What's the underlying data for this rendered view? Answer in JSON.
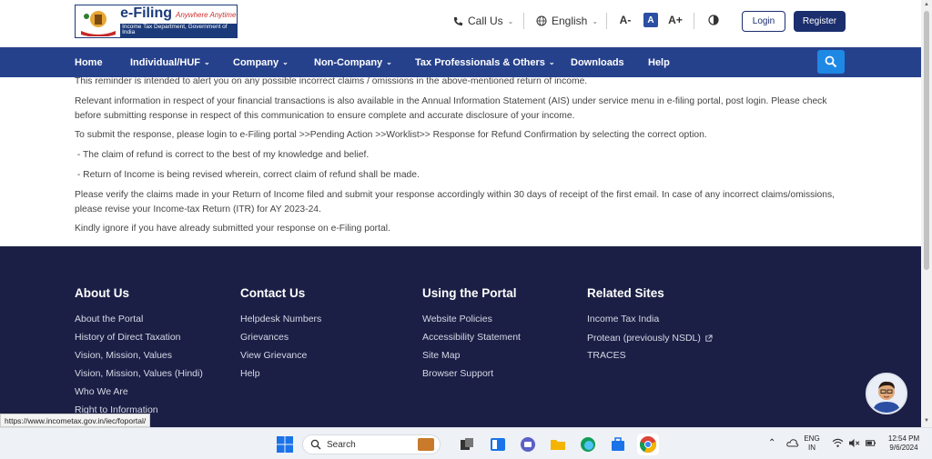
{
  "header": {
    "logo": {
      "title": "e-Filing",
      "tagline": "Anywhere Anytime",
      "subtitle": "Income Tax Department, Government of India"
    },
    "call_us": "Call Us",
    "language": "English",
    "font_decrease": "A-",
    "font_normal": "A",
    "font_increase": "A+",
    "login": "Login",
    "register": "Register"
  },
  "nav": {
    "items": [
      {
        "label": "Home",
        "dropdown": false
      },
      {
        "label": "Individual/HUF",
        "dropdown": true
      },
      {
        "label": "Company",
        "dropdown": true
      },
      {
        "label": "Non-Company",
        "dropdown": true
      },
      {
        "label": "Tax Professionals & Others",
        "dropdown": true
      },
      {
        "label": "Downloads",
        "dropdown": false
      },
      {
        "label": "Help",
        "dropdown": false
      }
    ]
  },
  "content": {
    "paragraphs": [
      "This reminder is intended to alert you on any possible incorrect claims / omissions in the above-mentioned return of income.",
      "Relevant information in respect of your financial transactions is also available in the Annual Information Statement (AIS) under service menu in e-filing portal, post login. Please check before submitting response in respect of this communication to ensure complete and accurate disclosure of your income.",
      "To submit the response, please login to e-Filing portal >>Pending Action >>Worklist>> Response for Refund Confirmation by selecting the correct option.",
      " - The claim of refund is correct to the best of my knowledge and belief.",
      " - Return of Income is being revised wherein, correct claim of refund shall be made.",
      "Please verify the claims made in your Return of Income filed and submit your response accordingly within 30 days of receipt of the first email. In case of any incorrect claims/omissions, please revise your Income-tax Return (ITR) for AY 2023-24.",
      "Kindly ignore if you have already submitted your response on e-Filing portal."
    ]
  },
  "footer": {
    "about": {
      "heading": "About Us",
      "links": [
        "About the Portal",
        "History of Direct Taxation",
        "Vision, Mission, Values",
        "Vision, Mission, Values (Hindi)",
        "Who We Are",
        "Right to Information"
      ]
    },
    "contact": {
      "heading": "Contact Us",
      "links": [
        "Helpdesk Numbers",
        "Grievances",
        "View Grievance",
        "Help"
      ]
    },
    "portal": {
      "heading": "Using the Portal",
      "links": [
        "Website Policies",
        "Accessibility Statement",
        "Site Map",
        "Browser Support"
      ]
    },
    "related": {
      "heading": "Related Sites",
      "links": [
        "Income Tax India",
        "Protean (previously NSDL)",
        "TRACES"
      ]
    }
  },
  "status_url": "https://www.incometax.gov.in/iec/foportal/",
  "taskbar": {
    "search_placeholder": "Search",
    "lang_line1": "ENG",
    "lang_line2": "IN",
    "time": "12:54 PM",
    "date": "9/6/2024"
  },
  "colors": {
    "nav_bg": "#26418c",
    "footer_bg": "#1b1f45",
    "primary": "#1b2e6e",
    "search_btn": "#1e88e5"
  }
}
